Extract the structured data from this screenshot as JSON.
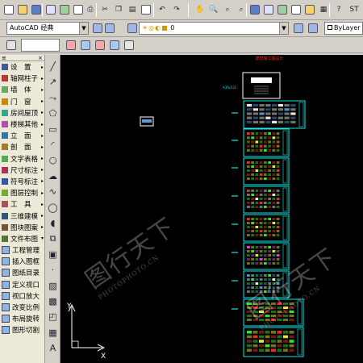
{
  "toolbar_top": {
    "buttons": [
      "new-icon",
      "open-icon",
      "save-icon",
      "plot-icon",
      "plot-preview-icon",
      "publish-icon",
      "print-icon",
      "cut-icon",
      "copy-icon",
      "paste-icon",
      "match-properties-icon",
      "undo-icon",
      "redo-icon",
      "pan-icon",
      "zoom-realtime-icon",
      "zoom-window-icon",
      "zoom-previous-icon",
      "properties-icon",
      "design-center-icon",
      "tool-palette-icon",
      "sheet-set-icon",
      "markup-icon",
      "calculator-icon",
      "help-icon",
      "text-style-icon"
    ],
    "text_style_value": "ST"
  },
  "toolbar_workspace": {
    "workspace_value": "AutoCAD 经典",
    "layer_value": "0",
    "color_value": "ByLayer"
  },
  "side_menu": {
    "items": [
      {
        "label": "设　置",
        "arrow": "▸",
        "sub": false
      },
      {
        "label": "轴网柱子",
        "arrow": "▸",
        "sub": false
      },
      {
        "label": "墙　体",
        "arrow": "▸",
        "sub": false
      },
      {
        "label": "门　窗",
        "arrow": "▸",
        "sub": false
      },
      {
        "label": "房间屋顶",
        "arrow": "▸",
        "sub": false
      },
      {
        "label": "楼梯其他",
        "arrow": "▸",
        "sub": false
      },
      {
        "label": "立　面",
        "arrow": "▸",
        "sub": false
      },
      {
        "label": "剖　面",
        "arrow": "▸",
        "sub": false
      },
      {
        "label": "文字表格",
        "arrow": "▸",
        "sub": false
      },
      {
        "label": "尺寸标注",
        "arrow": "▸",
        "sub": false
      },
      {
        "label": "符号标注",
        "arrow": "▸",
        "sub": false
      },
      {
        "label": "图层控制",
        "arrow": "▸",
        "sub": false
      },
      {
        "label": "工　具",
        "arrow": "▸",
        "sub": false
      },
      {
        "label": "三维建模",
        "arrow": "▸",
        "sub": false
      },
      {
        "label": "图块图案",
        "arrow": "▸",
        "sub": false
      },
      {
        "label": "文件布图",
        "arrow": "▾",
        "sub": false
      },
      {
        "label": "工程管理",
        "arrow": "",
        "sub": true
      },
      {
        "label": "插入图框",
        "arrow": "",
        "sub": true
      },
      {
        "label": "图纸目录",
        "arrow": "",
        "sub": true
      },
      {
        "label": "定义视口",
        "arrow": "",
        "sub": true
      },
      {
        "label": "视口放大",
        "arrow": "",
        "sub": true
      },
      {
        "label": "改变比例",
        "arrow": "",
        "sub": true
      },
      {
        "label": "布局旋转",
        "arrow": "",
        "sub": true
      },
      {
        "label": "图形切割",
        "arrow": "",
        "sub": true
      }
    ]
  },
  "draw_toolbar": [
    "line-icon",
    "construction-line-icon",
    "polyline-icon",
    "polygon-icon",
    "rectangle-icon",
    "arc-icon",
    "circle-icon",
    "revision-cloud-icon",
    "spline-icon",
    "ellipse-icon",
    "ellipse-arc-icon",
    "insert-block-icon",
    "make-block-icon",
    "point-icon",
    "hatch-icon",
    "gradient-icon",
    "region-icon",
    "table-icon",
    "multiline-text-icon"
  ],
  "canvas": {
    "ucs": {
      "x_label": "X",
      "y_label": "Y"
    },
    "watermarks": [
      {
        "big": "图行天下",
        "small": "PHOTOPHOTO.CN"
      },
      {
        "big": "图行天下",
        "small": "PHOTOPHOTO.CN"
      }
    ],
    "sheet_title": "建筑施工图设计"
  }
}
